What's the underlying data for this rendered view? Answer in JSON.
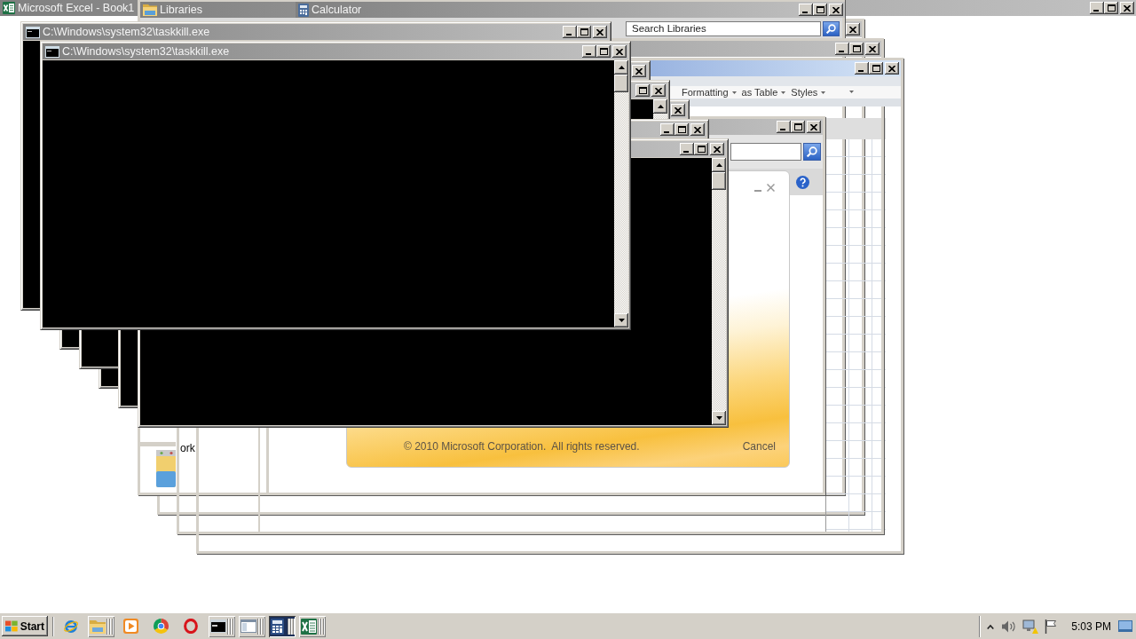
{
  "excel_window": {
    "title": "Microsoft Excel - Book1"
  },
  "libraries_window": {
    "title": "Libraries",
    "search": {
      "placeholder": "Search Libraries"
    },
    "nav_items": [
      {
        "label": "ork"
      }
    ]
  },
  "calculator_window": {
    "title": "Calculator"
  },
  "excel_ribbon": {
    "buttons": [
      {
        "label": "Formatting"
      },
      {
        "label": "as Table"
      },
      {
        "label": "Styles"
      }
    ]
  },
  "console_windows": [
    {
      "title": "C:\\Windows\\system32\\taskkill.exe"
    },
    {
      "title": "C:\\Windows\\system32\\taskkill.exe"
    }
  ],
  "installer_dialog": {
    "copyright": "© 2010 Microsoft Corporation.  All rights reserved.",
    "cancel_button": "Cancel"
  },
  "taskbar": {
    "start_button": "Start",
    "items": [
      {
        "kind": "browser",
        "stacked": false,
        "selected": false
      },
      {
        "kind": "explorer",
        "stacked": true,
        "selected": false
      },
      {
        "kind": "media",
        "stacked": false,
        "selected": false
      },
      {
        "kind": "chrome",
        "stacked": false,
        "selected": false
      },
      {
        "kind": "opera",
        "stacked": false,
        "selected": false
      },
      {
        "kind": "console",
        "stacked": true,
        "selected": false
      },
      {
        "kind": "window",
        "stacked": true,
        "selected": false
      },
      {
        "kind": "calculator",
        "stacked": true,
        "selected": true
      },
      {
        "kind": "excel",
        "stacked": true,
        "selected": false
      }
    ],
    "clock": "5:03 PM"
  }
}
